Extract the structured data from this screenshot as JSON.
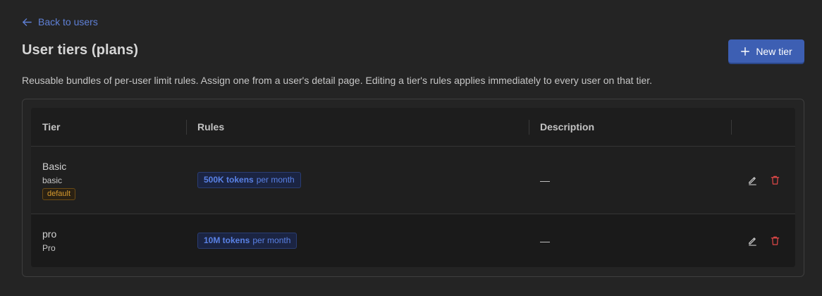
{
  "nav": {
    "back_label": "Back to users"
  },
  "header": {
    "title": "User tiers (plans)",
    "new_tier_label": "New tier",
    "description": "Reusable bundles of per-user limit rules. Assign one from a user's detail page. Editing a tier's rules applies immediately to every user on that tier."
  },
  "table": {
    "columns": [
      "Tier",
      "Rules",
      "Description",
      ""
    ],
    "rows": [
      {
        "name": "Basic",
        "slug": "basic",
        "badge": "default",
        "rule_amount": "500K tokens",
        "rule_period": "per month",
        "description": "—"
      },
      {
        "name": "pro",
        "slug": "Pro",
        "rule_amount": "10M tokens",
        "rule_period": "per month",
        "description": "—"
      }
    ]
  },
  "colors": {
    "accent": "#3d5fb3",
    "link": "#5f80d6",
    "danger": "#e04848",
    "badge_warning": "#d79a2e"
  },
  "icons": {
    "back": "arrow-left-icon",
    "new": "plus-icon",
    "edit": "pencil-icon",
    "delete": "trash-icon"
  }
}
